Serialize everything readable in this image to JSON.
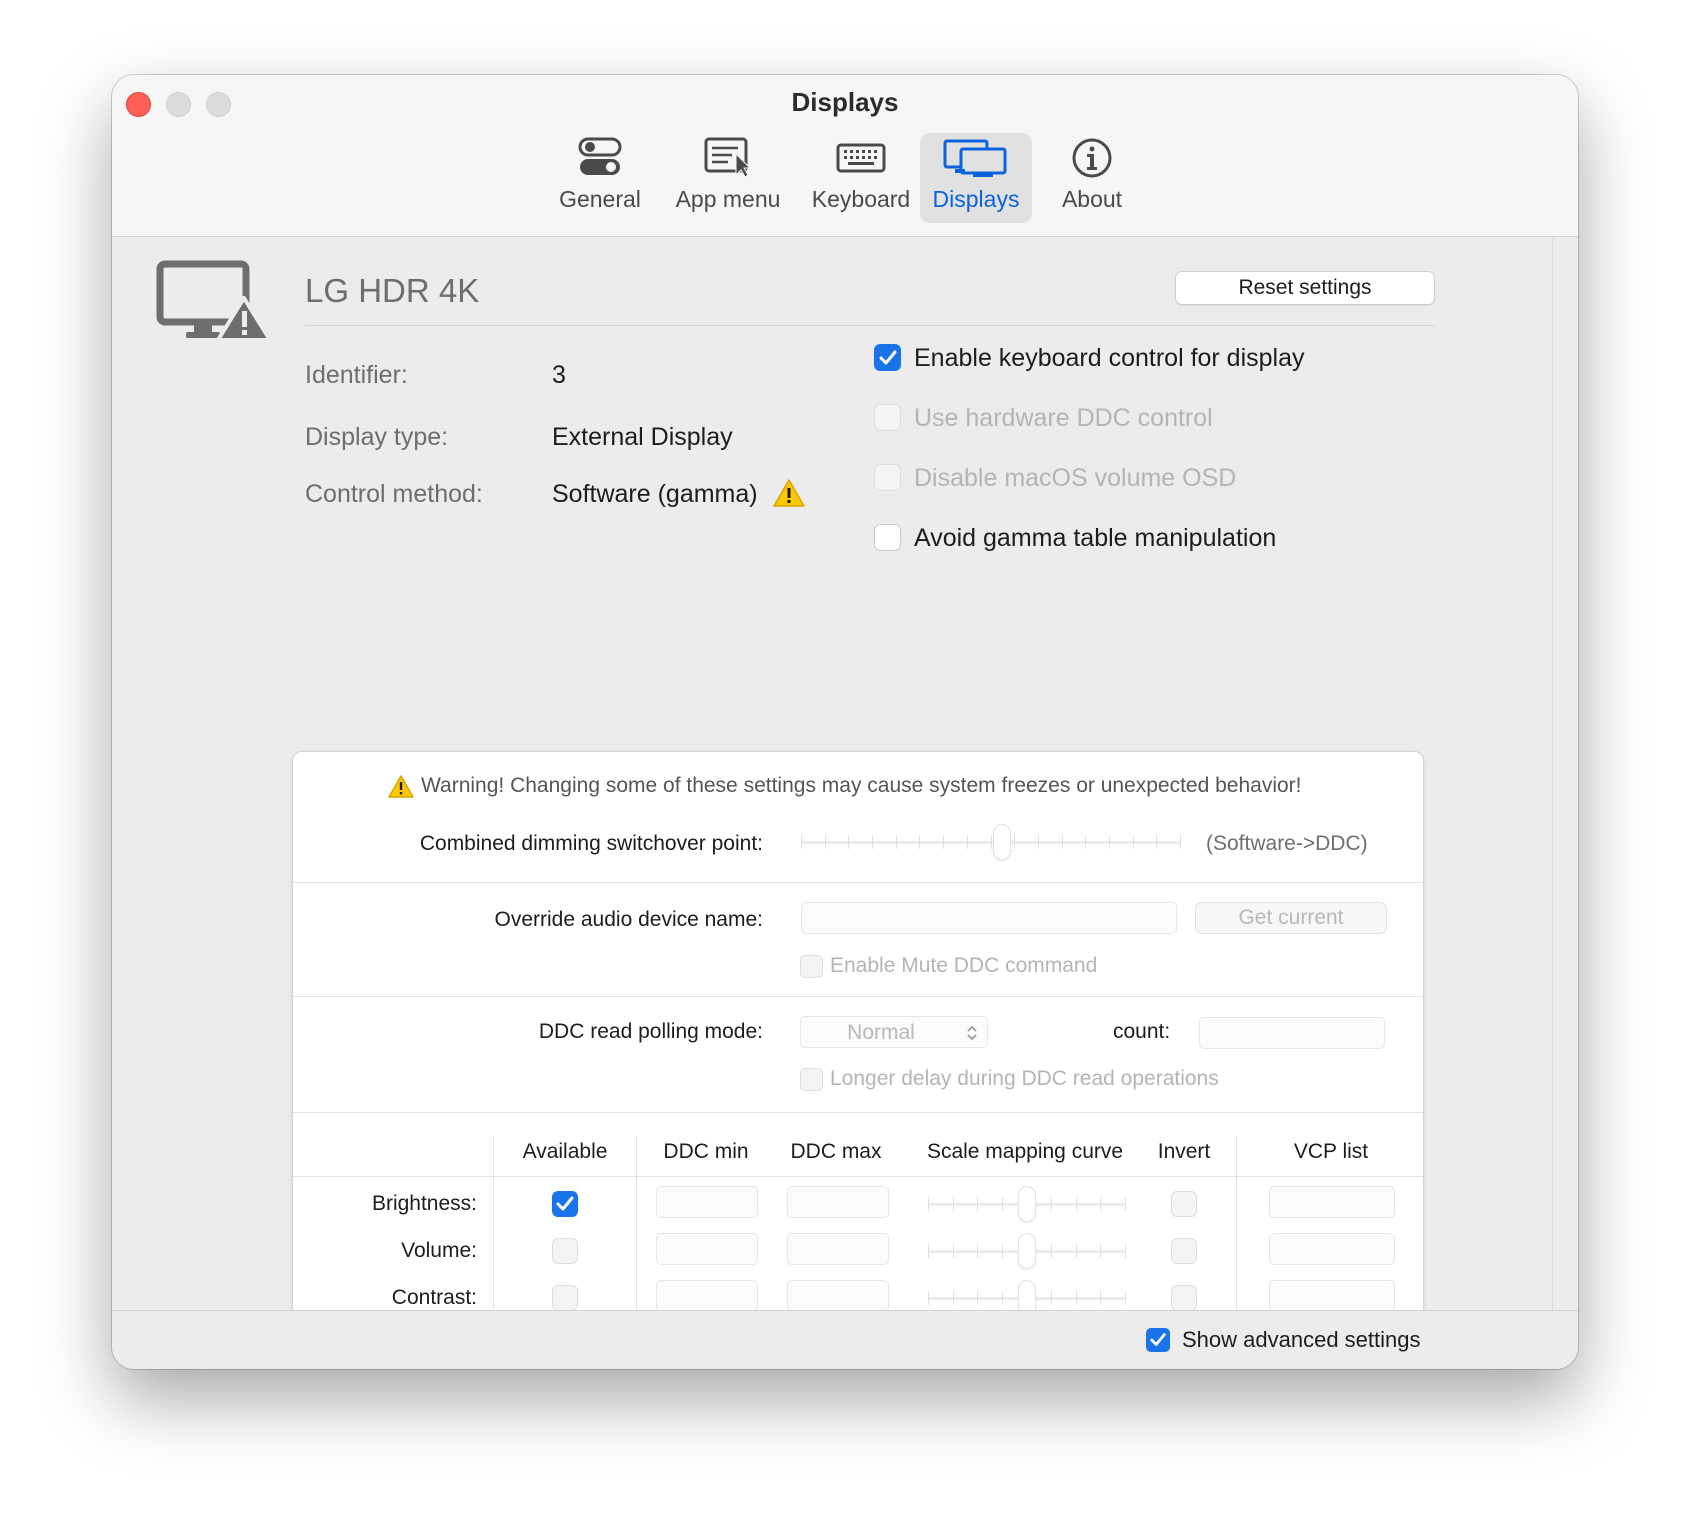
{
  "window": {
    "title": "Displays"
  },
  "tabs": [
    {
      "label": "General",
      "icon": "toggles-icon",
      "selected": false
    },
    {
      "label": "App menu",
      "icon": "menu-pointer-icon",
      "selected": false
    },
    {
      "label": "Keyboard",
      "icon": "keyboard-icon",
      "selected": false
    },
    {
      "label": "Displays",
      "icon": "displays-icon",
      "selected": true
    },
    {
      "label": "About",
      "icon": "info-icon",
      "selected": false
    }
  ],
  "display": {
    "name": "LG HDR 4K",
    "reset_label": "Reset settings",
    "identifier_label": "Identifier:",
    "identifier_value": "3",
    "type_label": "Display type:",
    "type_value": "External Display",
    "method_label": "Control method:",
    "method_value": "Software (gamma)"
  },
  "options": [
    {
      "label": "Enable keyboard control for display",
      "checked": true,
      "enabled": true
    },
    {
      "label": "Use hardware DDC control",
      "checked": false,
      "enabled": false
    },
    {
      "label": "Disable macOS volume OSD",
      "checked": false,
      "enabled": false
    },
    {
      "label": "Avoid gamma table manipulation",
      "checked": false,
      "enabled": true
    }
  ],
  "advanced": {
    "warning": "Warning! Changing some of these settings may cause system freezes or unexpected behavior!",
    "switchover_label": "Combined dimming switchover point:",
    "switchover_suffix": "(Software->DDC)",
    "switchover_value": 0.53,
    "audio_label": "Override audio device name:",
    "audio_value": "",
    "get_current_label": "Get current",
    "mute_label": "Enable Mute DDC command",
    "polling_label": "DDC read polling mode:",
    "polling_value": "Normal",
    "count_label": "count:",
    "count_value": "",
    "longer_delay_label": "Longer delay during DDC read operations",
    "columns": [
      "Available",
      "DDC min",
      "DDC max",
      "Scale mapping curve",
      "Invert",
      "VCP list"
    ],
    "rows": [
      {
        "label": "Brightness:",
        "available": true,
        "min": "",
        "max": "",
        "curve": 0.5,
        "invert": false,
        "vcp": ""
      },
      {
        "label": "Volume:",
        "available": false,
        "min": "",
        "max": "",
        "curve": 0.5,
        "invert": false,
        "vcp": ""
      },
      {
        "label": "Contrast:",
        "available": false,
        "min": "",
        "max": "",
        "curve": 0.5,
        "invert": false,
        "vcp": ""
      }
    ]
  },
  "footer": {
    "show_advanced_label": "Show advanced settings",
    "show_advanced_checked": true
  },
  "colors": {
    "accent": "#1a73e8",
    "close": "#ff5f57",
    "warning": "#ffc800"
  }
}
